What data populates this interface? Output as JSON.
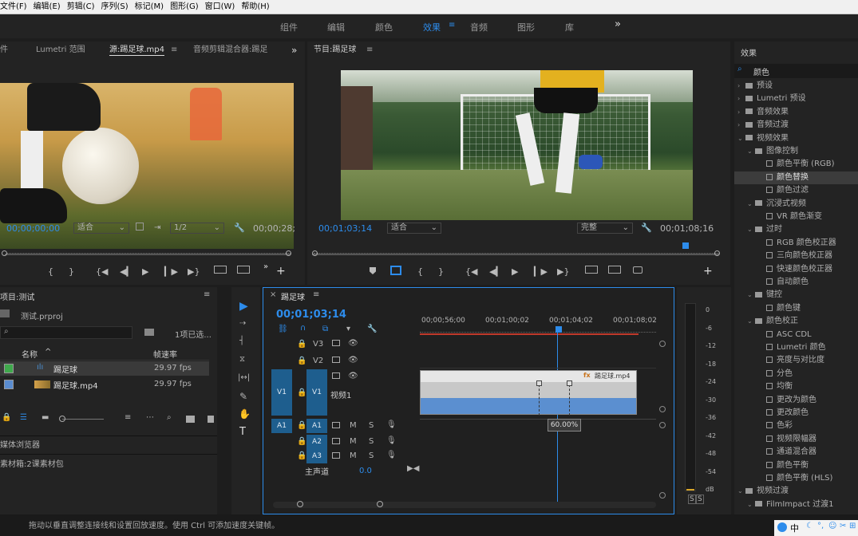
{
  "menu": [
    "文件(F)",
    "编辑(E)",
    "剪辑(C)",
    "序列(S)",
    "标记(M)",
    "图形(G)",
    "窗口(W)",
    "帮助(H)"
  ],
  "workspaces": [
    "组件",
    "编辑",
    "颜色",
    "效果",
    "音频",
    "图形",
    "库"
  ],
  "active_workspace": "效果",
  "more_glyph": "»",
  "source": {
    "tabs": [
      "件",
      "Lumetri 范围",
      "源:踢足球.mp4",
      "音频剪辑混合器:踢足"
    ],
    "timecode": "00;00;00;00",
    "fit": "适合",
    "res": "1/2",
    "duration": "00;00;28;"
  },
  "program": {
    "title": "节目:踢足球",
    "timecode": "00;01;03;14",
    "fit": "适合",
    "quality": "完整",
    "duration": "00;01;08;16"
  },
  "project": {
    "title": "项目:测试",
    "file": "测试.prproj",
    "count": "1项已选...",
    "col_name": "名称",
    "col_fps": "帧速率",
    "items": [
      {
        "name": "踢足球",
        "fps": "29.97 fps",
        "color": "#3fa94c"
      },
      {
        "name": "踢足球.mp4",
        "fps": "29.97 fps",
        "color": "#5a8ccf"
      }
    ],
    "media_browser": "媒体浏览器",
    "bin": "素材箱:2课素材包"
  },
  "timeline": {
    "tab": "踢足球",
    "timecode": "00;01;03;14",
    "ruler": [
      "00;00;56;00",
      "00;01;00;02",
      "00;01;04;02",
      "00;01;08;02"
    ],
    "tracks_v": [
      "V3",
      "V2",
      "V1"
    ],
    "tracks_a": [
      "A1",
      "A2",
      "A3"
    ],
    "v1_name": "视频1",
    "master": "主声道",
    "master_val": "0.0",
    "clip_name": "踢足球.mp4",
    "speed_tip": "60.00%",
    "m": "M",
    "s": "S"
  },
  "meter": {
    "ticks": [
      "0",
      "-6",
      "-12",
      "-18",
      "-24",
      "-30",
      "-36",
      "-42",
      "-48",
      "-54",
      "dB"
    ],
    "solo": [
      "S",
      "S"
    ]
  },
  "effects": {
    "title": "效果",
    "search": "颜色",
    "items": [
      {
        "label": "预设",
        "type": "folder",
        "indent": 0,
        "open": false
      },
      {
        "label": "Lumetri 预设",
        "type": "folder",
        "indent": 0,
        "open": false
      },
      {
        "label": "音频效果",
        "type": "folder",
        "indent": 0,
        "open": false
      },
      {
        "label": "音频过渡",
        "type": "folder",
        "indent": 0,
        "open": false
      },
      {
        "label": "视频效果",
        "type": "folder",
        "indent": 0,
        "open": true
      },
      {
        "label": "图像控制",
        "type": "folder",
        "indent": 1,
        "open": true
      },
      {
        "label": "颜色平衡 (RGB)",
        "type": "preset",
        "indent": 2
      },
      {
        "label": "颜色替换",
        "type": "preset",
        "indent": 2,
        "selected": true
      },
      {
        "label": "颜色过滤",
        "type": "preset",
        "indent": 2
      },
      {
        "label": "沉浸式视频",
        "type": "folder",
        "indent": 1,
        "open": true
      },
      {
        "label": "VR 颜色渐变",
        "type": "preset",
        "indent": 2
      },
      {
        "label": "过时",
        "type": "folder",
        "indent": 1,
        "open": true
      },
      {
        "label": "RGB 颜色校正器",
        "type": "preset",
        "indent": 2
      },
      {
        "label": "三向颜色校正器",
        "type": "preset",
        "indent": 2
      },
      {
        "label": "快速颜色校正器",
        "type": "preset",
        "indent": 2
      },
      {
        "label": "自动颜色",
        "type": "preset",
        "indent": 2
      },
      {
        "label": "键控",
        "type": "folder",
        "indent": 1,
        "open": true
      },
      {
        "label": "颜色键",
        "type": "preset",
        "indent": 2
      },
      {
        "label": "颜色校正",
        "type": "folder",
        "indent": 1,
        "open": true
      },
      {
        "label": "ASC CDL",
        "type": "preset",
        "indent": 2
      },
      {
        "label": "Lumetri 颜色",
        "type": "preset",
        "indent": 2
      },
      {
        "label": "亮度与对比度",
        "type": "preset",
        "indent": 2
      },
      {
        "label": "分色",
        "type": "preset",
        "indent": 2
      },
      {
        "label": "均衡",
        "type": "preset",
        "indent": 2
      },
      {
        "label": "更改为颜色",
        "type": "preset",
        "indent": 2
      },
      {
        "label": "更改颜色",
        "type": "preset",
        "indent": 2
      },
      {
        "label": "色彩",
        "type": "preset",
        "indent": 2
      },
      {
        "label": "视频限幅器",
        "type": "preset",
        "indent": 2
      },
      {
        "label": "通道混合器",
        "type": "preset",
        "indent": 2
      },
      {
        "label": "颜色平衡",
        "type": "preset",
        "indent": 2
      },
      {
        "label": "颜色平衡 (HLS)",
        "type": "preset",
        "indent": 2
      },
      {
        "label": "视频过渡",
        "type": "folder",
        "indent": 0,
        "open": true
      },
      {
        "label": "FilmImpact 过渡1",
        "type": "folder",
        "indent": 1,
        "open": true
      }
    ]
  },
  "status": "拖动以垂直调整连接线和设置回放速度。使用 Ctrl 可添加速度关键帧。",
  "tray": "中",
  "glyphs": {
    "play": "▶",
    "step_back": "◀▎",
    "step_fwd": "▎▶",
    "goto_in": "{◀",
    "goto_out": "▶}",
    "mark_in": "{",
    "mark_out": "}",
    "plus": "+",
    "dropdown": "⌄",
    "wrench": "🔧",
    "chevron": "❯",
    "arrow_down": "⌄",
    "arrow_right": "›",
    "eye": "👁",
    "lock": "🔒",
    "search": "⌕",
    "menu": "≡",
    "close": "×",
    "fx": "fx",
    "pen": "✎",
    "hand": "✋",
    "type": "T"
  }
}
